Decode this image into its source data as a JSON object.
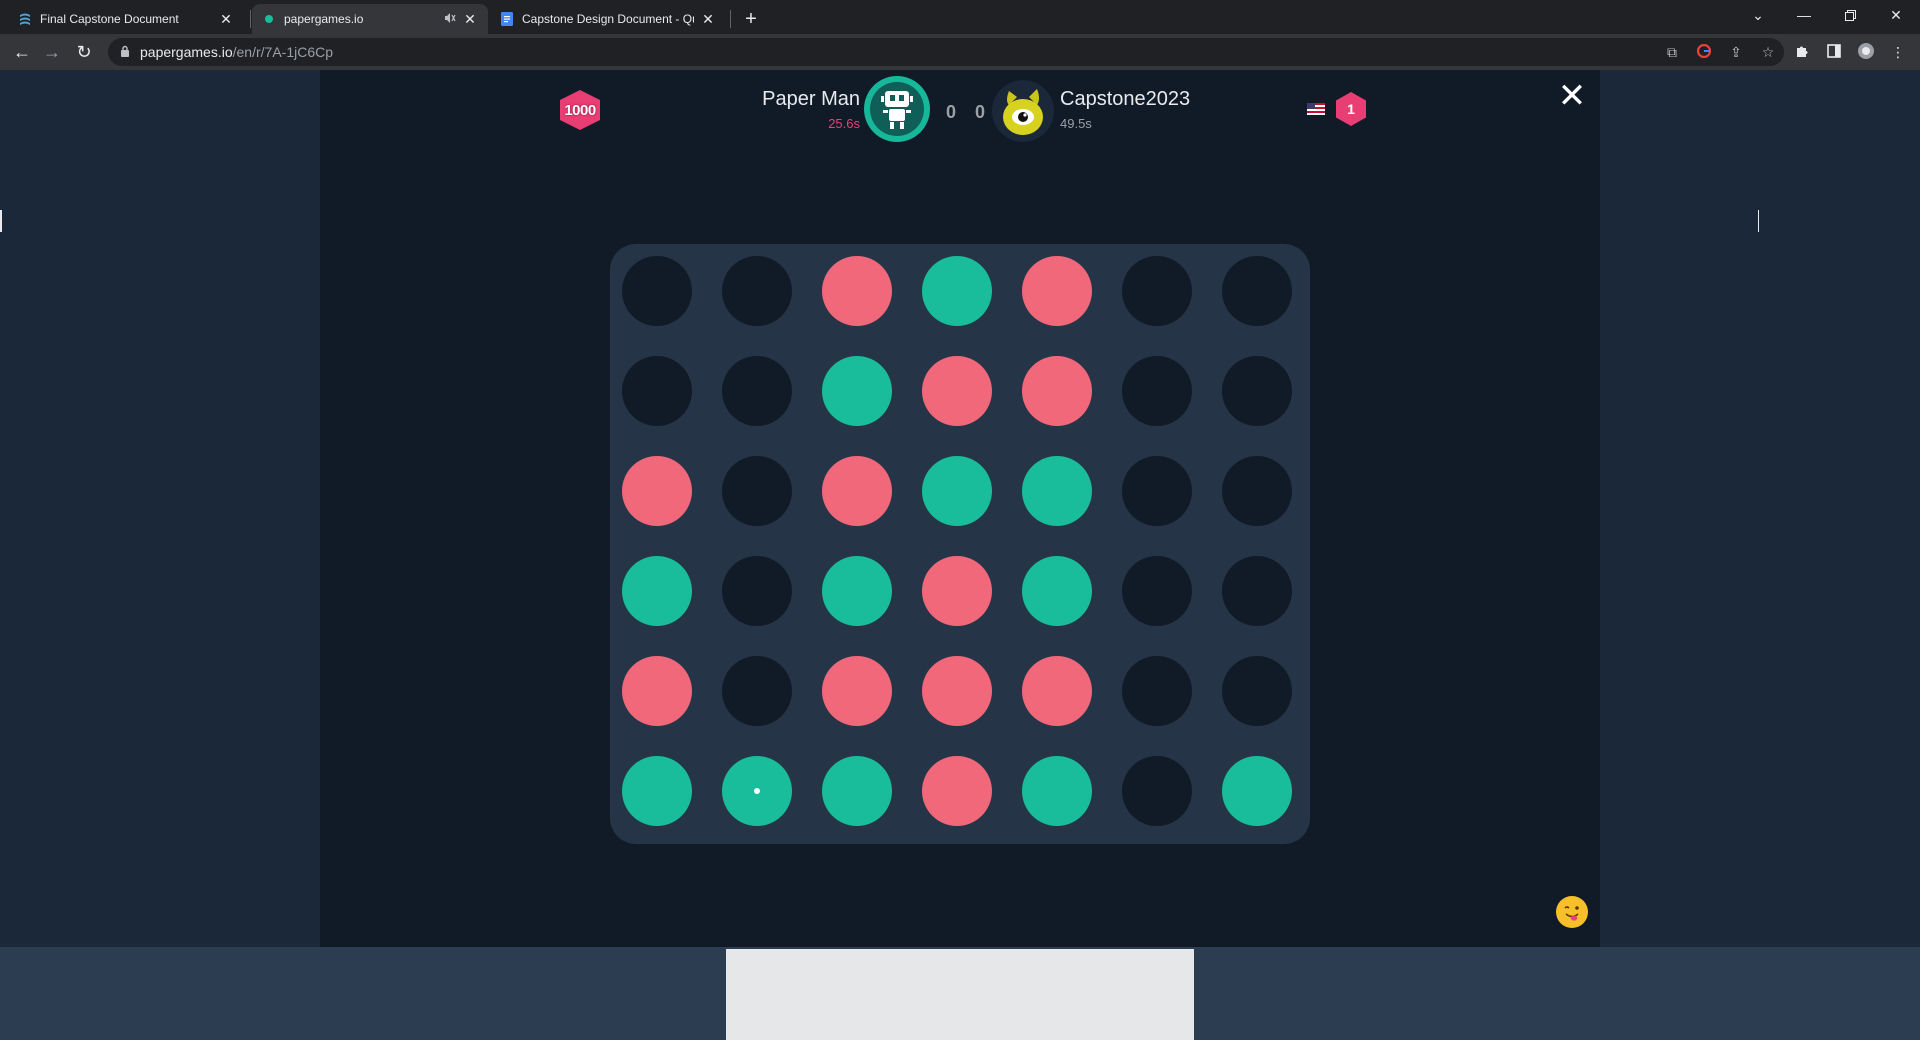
{
  "browser": {
    "tabs": [
      {
        "title": "Final Capstone Document",
        "active": false
      },
      {
        "title": "papergames.io",
        "active": true
      },
      {
        "title": "Capstone Design Document - Qu",
        "active": false
      }
    ],
    "url_host": "papergames.io",
    "url_path": "/en/r/7A-1jC6Cp"
  },
  "header": {
    "rating_label": "1000",
    "player1": {
      "name": "Paper Man",
      "time": "25.6s"
    },
    "player2": {
      "name": "Capstone2023",
      "time": "49.5s"
    },
    "score1": "0",
    "score2": "0",
    "player2_level": "1"
  },
  "colors": {
    "red_piece": "#f0687a",
    "green_piece": "#19bc9b",
    "empty_slot": "#111a27",
    "board": "#253446"
  },
  "board": {
    "rows": [
      [
        "empty",
        "empty",
        "red",
        "green",
        "red",
        "empty",
        "empty"
      ],
      [
        "empty",
        "empty",
        "green",
        "red",
        "red",
        "empty",
        "empty"
      ],
      [
        "red",
        "empty",
        "red",
        "green",
        "green",
        "empty",
        "empty"
      ],
      [
        "green",
        "empty",
        "green",
        "red",
        "green",
        "empty",
        "empty"
      ],
      [
        "red",
        "empty",
        "red",
        "red",
        "red",
        "empty",
        "empty"
      ],
      [
        "green",
        "green",
        "green",
        "red",
        "green",
        "empty",
        "green"
      ]
    ],
    "last_move": {
      "row": 5,
      "col": 1
    }
  }
}
